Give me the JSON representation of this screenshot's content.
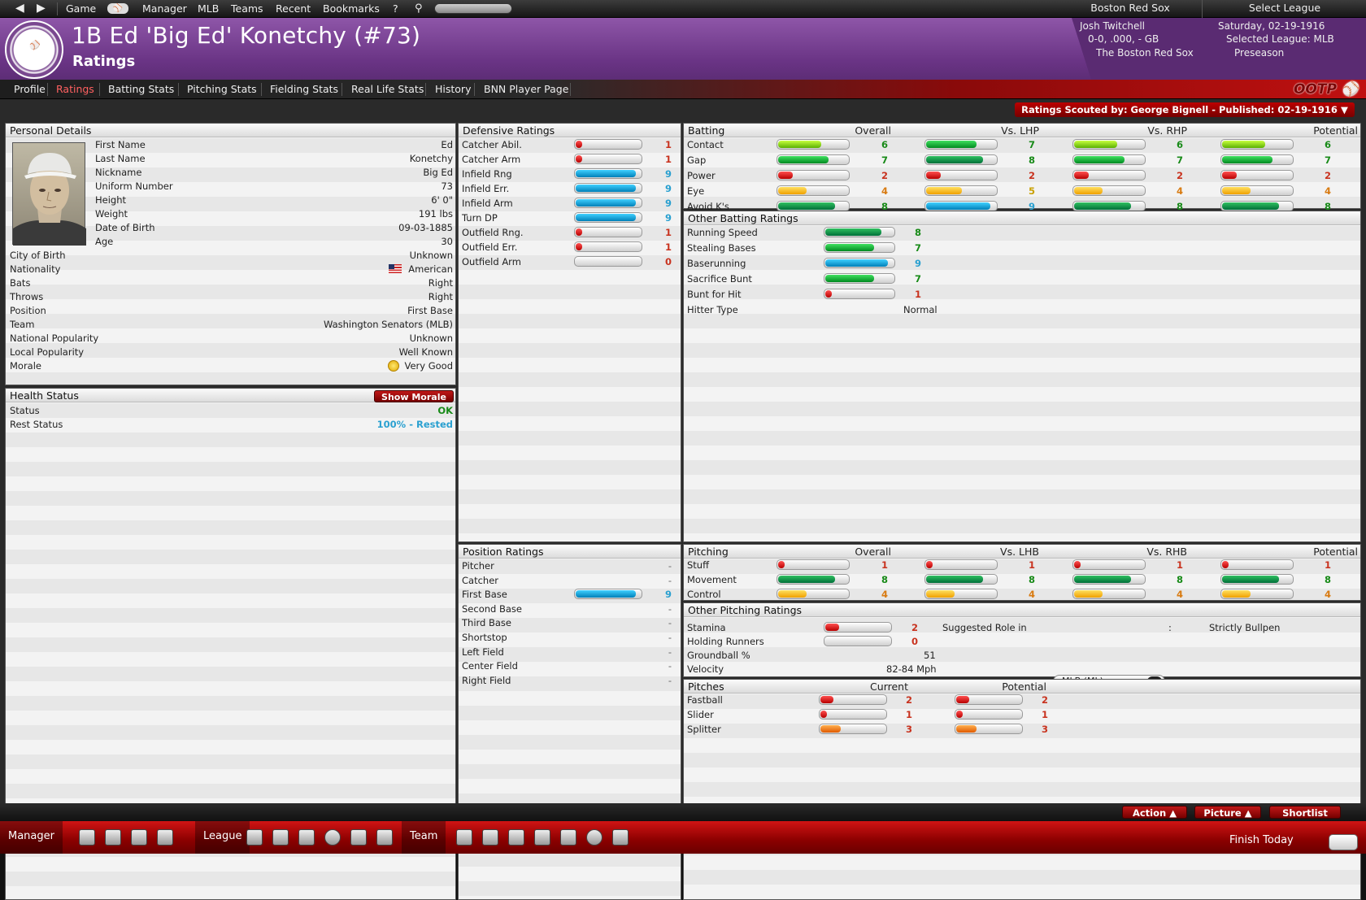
{
  "topbar": {
    "items": [
      "Game",
      "Manager",
      "MLB",
      "Teams",
      "Recent",
      "Bookmarks",
      "?"
    ],
    "team": "Boston Red Sox",
    "select_league": "Select League"
  },
  "header": {
    "title": "1B Ed 'Big Ed' Konetchy (#73)",
    "subtitle": "Ratings",
    "manager": {
      "name": "Josh Twitchell",
      "record": "0-0, .000, - GB",
      "team": "The Boston Red Sox",
      "date": "Saturday, 02-19-1916",
      "league": "Selected League: MLB",
      "phase": "Preseason"
    }
  },
  "tabs": [
    "Profile",
    "Ratings",
    "Batting Stats",
    "Pitching Stats",
    "Fielding Stats",
    "Real Life Stats",
    "History",
    "BNN Player Page"
  ],
  "active_tab": "Ratings",
  "scouted": "Ratings Scouted by: George Bignell - Published: 02-19-1916",
  "personal": {
    "title": "Personal Details",
    "rows": [
      {
        "label": "First Name",
        "value": "Ed"
      },
      {
        "label": "Last Name",
        "value": "Konetchy"
      },
      {
        "label": "Nickname",
        "value": "Big Ed"
      },
      {
        "label": "Uniform Number",
        "value": "73"
      },
      {
        "label": "Height",
        "value": "6' 0\""
      },
      {
        "label": "Weight",
        "value": "191 lbs"
      },
      {
        "label": "Date of Birth",
        "value": "09-03-1885"
      },
      {
        "label": "Age",
        "value": "30"
      },
      {
        "label": "City of Birth",
        "value": "Unknown"
      },
      {
        "label": "Nationality",
        "value": "American"
      },
      {
        "label": "Bats",
        "value": "Right"
      },
      {
        "label": "Throws",
        "value": "Right"
      },
      {
        "label": "Position",
        "value": "First Base"
      },
      {
        "label": "Team",
        "value": "Washington Senators (MLB)"
      },
      {
        "label": "National Popularity",
        "value": "Unknown"
      },
      {
        "label": "Local Popularity",
        "value": "Well Known"
      },
      {
        "label": "Morale",
        "value": "Very Good"
      }
    ]
  },
  "health": {
    "title": "Health Status",
    "button": "Show Morale",
    "rows": [
      {
        "label": "Status",
        "value": "OK"
      },
      {
        "label": "Rest Status",
        "value": "100% - Rested"
      }
    ]
  },
  "defensive": {
    "title": "Defensive Ratings",
    "rows": [
      {
        "label": "Catcher Abil.",
        "value": "1"
      },
      {
        "label": "Catcher Arm",
        "value": "1"
      },
      {
        "label": "Infield Rng",
        "value": "9"
      },
      {
        "label": "Infield Err.",
        "value": "9"
      },
      {
        "label": "Infield Arm",
        "value": "9"
      },
      {
        "label": "Turn DP",
        "value": "9"
      },
      {
        "label": "Outfield Rng.",
        "value": "1"
      },
      {
        "label": "Outfield Err.",
        "value": "1"
      },
      {
        "label": "Outfield Arm",
        "value": "0"
      }
    ]
  },
  "position": {
    "title": "Position Ratings",
    "rows": [
      {
        "label": "Pitcher",
        "value": "-"
      },
      {
        "label": "Catcher",
        "value": "-"
      },
      {
        "label": "First Base",
        "value": "9"
      },
      {
        "label": "Second Base",
        "value": "-"
      },
      {
        "label": "Third Base",
        "value": "-"
      },
      {
        "label": "Shortstop",
        "value": "-"
      },
      {
        "label": "Left Field",
        "value": "-"
      },
      {
        "label": "Center Field",
        "value": "-"
      },
      {
        "label": "Right Field",
        "value": "-"
      }
    ]
  },
  "batting": {
    "title": "Batting",
    "cols": [
      "Overall",
      "Vs. LHP",
      "Vs. RHP",
      "Potential"
    ],
    "rows": [
      {
        "label": "Contact",
        "values": [
          "6",
          "7",
          "6",
          "6"
        ]
      },
      {
        "label": "Gap",
        "values": [
          "7",
          "8",
          "7",
          "7"
        ]
      },
      {
        "label": "Power",
        "values": [
          "2",
          "2",
          "2",
          "2"
        ]
      },
      {
        "label": "Eye",
        "values": [
          "4",
          "5",
          "4",
          "4"
        ]
      },
      {
        "label": "Avoid K's",
        "values": [
          "8",
          "9",
          "8",
          "8"
        ]
      }
    ]
  },
  "other_batting": {
    "title": "Other Batting Ratings",
    "rows": [
      {
        "label": "Running Speed",
        "value": "8"
      },
      {
        "label": "Stealing Bases",
        "value": "7"
      },
      {
        "label": "Baserunning",
        "value": "9"
      },
      {
        "label": "Sacrifice Bunt",
        "value": "7"
      },
      {
        "label": "Bunt for Hit",
        "value": "1"
      }
    ],
    "hitter_type_label": "Hitter Type",
    "hitter_type": "Normal"
  },
  "pitching": {
    "title": "Pitching",
    "cols": [
      "Overall",
      "Vs. LHB",
      "Vs. RHB",
      "Potential"
    ],
    "rows": [
      {
        "label": "Stuff",
        "values": [
          "1",
          "1",
          "1",
          "1"
        ]
      },
      {
        "label": "Movement",
        "values": [
          "8",
          "8",
          "8",
          "8"
        ]
      },
      {
        "label": "Control",
        "values": [
          "4",
          "4",
          "4",
          "4"
        ]
      }
    ]
  },
  "other_pitching": {
    "title": "Other Pitching Ratings",
    "stamina_label": "Stamina",
    "stamina": "2",
    "holding_label": "Holding Runners",
    "holding": "0",
    "groundball_label": "Groundball %",
    "groundball": "51",
    "velocity_label": "Velocity",
    "velocity": "82-84 Mph",
    "role_label": "Suggested Role in",
    "role_league": "MLB (ML)",
    "role_sep": ":",
    "role": "Strictly Bullpen"
  },
  "pitches": {
    "title": "Pitches",
    "cols": [
      "Current",
      "Potential"
    ],
    "rows": [
      {
        "label": "Fastball",
        "values": [
          "2",
          "2"
        ]
      },
      {
        "label": "Slider",
        "values": [
          "1",
          "1"
        ]
      },
      {
        "label": "Splitter",
        "values": [
          "3",
          "3"
        ]
      }
    ]
  },
  "actions": {
    "action": "Action",
    "picture": "Picture",
    "shortlist": "Shortlist"
  },
  "taskbar": {
    "manager": "Manager",
    "league": "League",
    "team": "Team",
    "finish": "Finish Today"
  }
}
